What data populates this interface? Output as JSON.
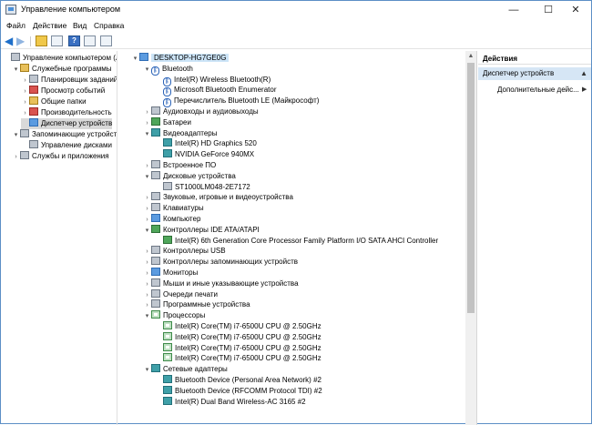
{
  "window": {
    "title": "Управление компьютером",
    "controls": {
      "minimize": "—",
      "maximize": "☐",
      "close": "✕"
    }
  },
  "menu": [
    "Файл",
    "Действие",
    "Вид",
    "Справка"
  ],
  "left_tree": [
    {
      "label": "Управление компьютером (лс",
      "expander": "",
      "icon": "computer-management-icon",
      "color": "c-gray"
    },
    {
      "label": "Служебные программы",
      "expander": "▾",
      "icon": "tools-icon",
      "color": "c-gold"
    },
    {
      "label": "Планировщик заданий",
      "expander": "›",
      "icon": "clock-icon",
      "color": "c-gray"
    },
    {
      "label": "Просмотр событий",
      "expander": "›",
      "icon": "event-viewer-icon",
      "color": "c-red"
    },
    {
      "label": "Общие папки",
      "expander": "›",
      "icon": "shared-folder-icon",
      "color": "c-gold"
    },
    {
      "label": "Производительность",
      "expander": "›",
      "icon": "performance-icon",
      "color": "c-red"
    },
    {
      "label": "Диспетчер устройств",
      "expander": "",
      "icon": "device-manager-icon",
      "color": "c-blue"
    },
    {
      "label": "Запоминающие устройств",
      "expander": "▾",
      "icon": "storage-icon",
      "color": "c-gray"
    },
    {
      "label": "Управление дисками",
      "expander": "",
      "icon": "disk-management-icon",
      "color": "c-gray"
    },
    {
      "label": "Службы и приложения",
      "expander": "›",
      "icon": "services-icon",
      "color": "c-gray"
    }
  ],
  "device_tree": [
    {
      "label": "DESKTOP-HG7GE0G",
      "expander": "▾",
      "icon": "computer-icon",
      "color": "c-blue",
      "level": 0,
      "root": true
    },
    {
      "label": "Bluetooth",
      "expander": "▾",
      "icon": "bluetooth-icon",
      "color": "bt",
      "level": 1
    },
    {
      "label": "Intel(R) Wireless Bluetooth(R)",
      "expander": "",
      "icon": "bluetooth-icon",
      "color": "bt",
      "level": 2
    },
    {
      "label": "Microsoft Bluetooth Enumerator",
      "expander": "",
      "icon": "bluetooth-icon",
      "color": "bt",
      "level": 2
    },
    {
      "label": "Перечислитель Bluetooth LE (Майкрософт)",
      "expander": "",
      "icon": "bluetooth-icon",
      "color": "bt",
      "level": 2
    },
    {
      "label": "Аудиовходы и аудиовыходы",
      "expander": "›",
      "icon": "audio-icon",
      "color": "c-gray",
      "level": 1
    },
    {
      "label": "Батареи",
      "expander": "›",
      "icon": "battery-icon",
      "color": "c-green",
      "level": 1
    },
    {
      "label": "Видеоадаптеры",
      "expander": "▾",
      "icon": "display-adapter-icon",
      "color": "c-teal",
      "level": 1
    },
    {
      "label": "Intel(R) HD Graphics 520",
      "expander": "",
      "icon": "display-adapter-icon",
      "color": "c-teal",
      "level": 2
    },
    {
      "label": "NVIDIA GeForce 940MX",
      "expander": "",
      "icon": "display-adapter-icon",
      "color": "c-teal",
      "level": 2
    },
    {
      "label": "Встроенное ПО",
      "expander": "›",
      "icon": "firmware-icon",
      "color": "c-gray",
      "level": 1
    },
    {
      "label": "Дисковые устройства",
      "expander": "▾",
      "icon": "disk-drive-icon",
      "color": "c-gray",
      "level": 1
    },
    {
      "label": "ST1000LM048-2E7172",
      "expander": "",
      "icon": "disk-drive-icon",
      "color": "c-gray",
      "level": 2
    },
    {
      "label": "Звуковые, игровые и видеоустройства",
      "expander": "›",
      "icon": "sound-icon",
      "color": "c-gray",
      "level": 1
    },
    {
      "label": "Клавиатуры",
      "expander": "›",
      "icon": "keyboard-icon",
      "color": "c-gray",
      "level": 1
    },
    {
      "label": "Компьютер",
      "expander": "›",
      "icon": "computer-icon",
      "color": "c-blue",
      "level": 1
    },
    {
      "label": "Контроллеры IDE ATA/ATAPI",
      "expander": "▾",
      "icon": "ide-controller-icon",
      "color": "c-green",
      "level": 1
    },
    {
      "label": "Intel(R) 6th Generation Core Processor Family Platform I/O SATA AHCI Controller",
      "expander": "",
      "icon": "ide-controller-icon",
      "color": "c-green",
      "level": 2
    },
    {
      "label": "Контроллеры USB",
      "expander": "›",
      "icon": "usb-icon",
      "color": "c-gray",
      "level": 1
    },
    {
      "label": "Контроллеры запоминающих устройств",
      "expander": "›",
      "icon": "storage-controller-icon",
      "color": "c-gray",
      "level": 1
    },
    {
      "label": "Мониторы",
      "expander": "›",
      "icon": "monitor-icon",
      "color": "c-blue",
      "level": 1
    },
    {
      "label": "Мыши и иные указывающие устройства",
      "expander": "›",
      "icon": "mouse-icon",
      "color": "c-gray",
      "level": 1
    },
    {
      "label": "Очереди печати",
      "expander": "›",
      "icon": "printer-icon",
      "color": "c-gray",
      "level": 1
    },
    {
      "label": "Программные устройства",
      "expander": "›",
      "icon": "software-device-icon",
      "color": "c-gray",
      "level": 1
    },
    {
      "label": "Процессоры",
      "expander": "▾",
      "icon": "processor-icon",
      "color": "cpu",
      "level": 1
    },
    {
      "label": "Intel(R) Core(TM) i7-6500U CPU @ 2.50GHz",
      "expander": "",
      "icon": "processor-icon",
      "color": "cpu",
      "level": 2
    },
    {
      "label": "Intel(R) Core(TM) i7-6500U CPU @ 2.50GHz",
      "expander": "",
      "icon": "processor-icon",
      "color": "cpu",
      "level": 2
    },
    {
      "label": "Intel(R) Core(TM) i7-6500U CPU @ 2.50GHz",
      "expander": "",
      "icon": "processor-icon",
      "color": "cpu",
      "level": 2
    },
    {
      "label": "Intel(R) Core(TM) i7-6500U CPU @ 2.50GHz",
      "expander": "",
      "icon": "processor-icon",
      "color": "cpu",
      "level": 2
    },
    {
      "label": "Сетевые адаптеры",
      "expander": "▾",
      "icon": "network-adapter-icon",
      "color": "c-teal",
      "level": 1
    },
    {
      "label": "Bluetooth Device (Personal Area Network) #2",
      "expander": "",
      "icon": "network-adapter-icon",
      "color": "c-teal",
      "level": 2
    },
    {
      "label": "Bluetooth Device (RFCOMM Protocol TDI) #2",
      "expander": "",
      "icon": "network-adapter-icon",
      "color": "c-teal",
      "level": 2
    },
    {
      "label": "Intel(R) Dual Band Wireless-AC 3165 #2",
      "expander": "",
      "icon": "network-adapter-icon",
      "color": "c-teal",
      "level": 2
    }
  ],
  "actions": {
    "header": "Действия",
    "selected": "Диспетчер устройств",
    "sub": "Дополнительные дейс..."
  },
  "colors": {
    "border": "#5c8fc6",
    "selection": "#cce4f7",
    "actions_selected": "#d6e6f5"
  }
}
